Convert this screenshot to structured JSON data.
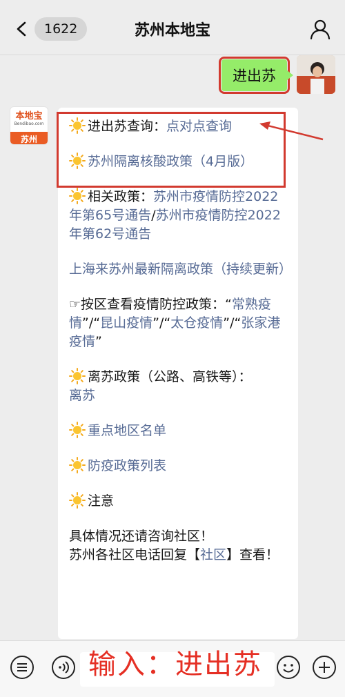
{
  "header": {
    "badge_count": "1622",
    "title": "苏州本地宝"
  },
  "outgoing": {
    "message": "进出苏"
  },
  "bot_avatar": {
    "logo_text": "本地宝",
    "logo_sub": "Bendibao.com",
    "city": "苏州"
  },
  "bubble": {
    "p1_prefix": "进出苏查询：",
    "p1_link": "点对点查询",
    "p2_link": "苏州隔离核酸政策（4月版）",
    "p3_prefix": "相关政策：",
    "p3_link1": "苏州市疫情防控2022年第65号通告",
    "p3_sep": "/",
    "p3_link2": "苏州市疫情防控2022年第62号通告",
    "p4_link": "上海来苏州最新隔离政策（持续更新）",
    "p5_prefix": "☞按区查看疫情防控政策：",
    "p5_q1": "“",
    "p5_link1": "常熟疫情",
    "p5_q2": "”/“",
    "p5_link2": "昆山疫情",
    "p5_q3": "”/“",
    "p5_link3": "太仓疫情",
    "p5_q4": "”/“",
    "p5_link4": "张家港疫情",
    "p5_q5": "”",
    "p6_prefix": "离苏政策（公路、高铁等）：",
    "p6_link": "离苏",
    "p7_link": "重点地区名单",
    "p8_link": "防疫政策列表",
    "p9_text": "注意",
    "p10_line1": "具体情况还请咨询社区！",
    "p10_line2a": "苏州各社区电话回复【",
    "p10_link": "社区",
    "p10_line2b": "】查看！"
  },
  "input_bar": {
    "overlay_label": "输入：进出苏"
  },
  "icons": {
    "back": "chevron-left-icon",
    "profile": "person-icon",
    "sun": "sun-emoji-icon",
    "menu": "menu-icon",
    "voice": "voice-icon",
    "emoji": "emoji-icon",
    "add": "plus-icon"
  },
  "colors": {
    "link": "#576b95",
    "outgoing_bubble": "#95ec69",
    "annotation_red": "#d23a2f",
    "overlay_red": "#e52f24",
    "brand_orange": "#ea5c24"
  }
}
